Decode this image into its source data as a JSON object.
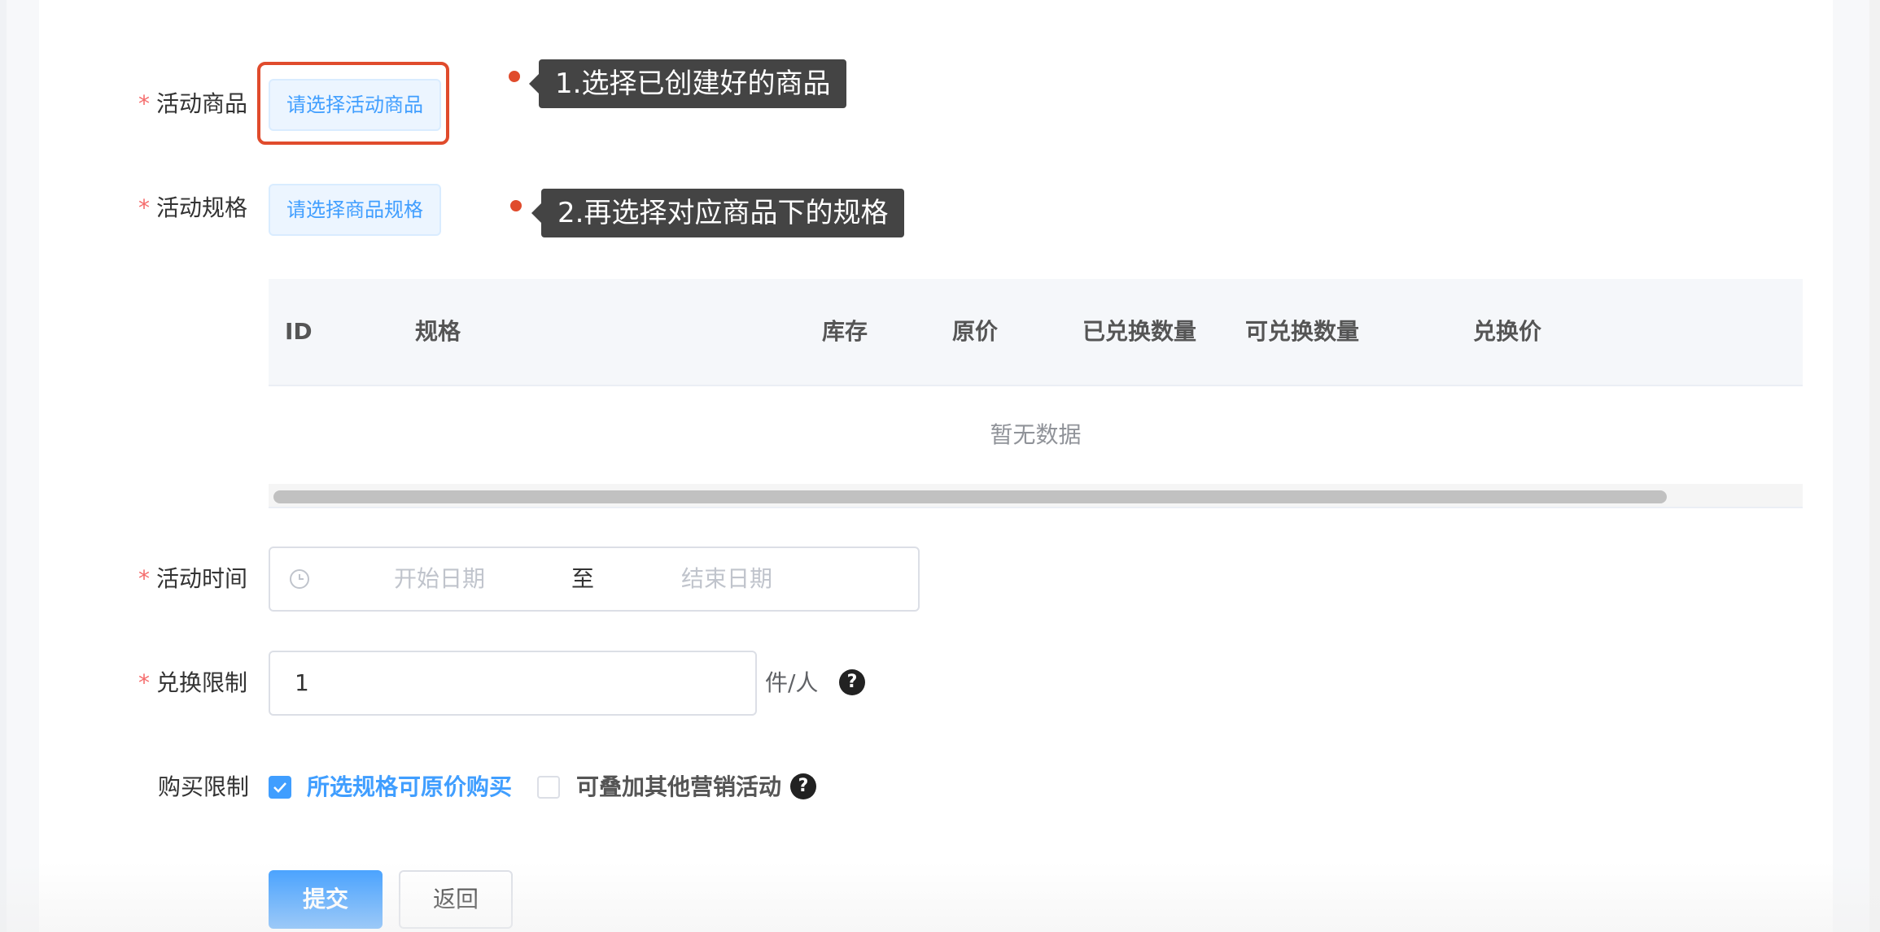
{
  "form": {
    "product": {
      "label": "活动商品",
      "button": "请选择活动商品",
      "tip": "1.选择已创建好的商品"
    },
    "spec": {
      "label": "活动规格",
      "button": "请选择商品规格",
      "tip": "2.再选择对应商品下的规格"
    },
    "table": {
      "columns": [
        "ID",
        "规格",
        "库存",
        "原价",
        "已兑换数量",
        "可兑换数量",
        "兑换价"
      ],
      "empty_text": "暂无数据"
    },
    "time": {
      "label": "活动时间",
      "start_placeholder": "开始日期",
      "separator": "至",
      "end_placeholder": "结束日期"
    },
    "limit": {
      "label": "兑换限制",
      "value": "1",
      "unit": "件/人",
      "help": "?"
    },
    "purchase": {
      "label": "购买限制",
      "option1": "所选规格可原价购买",
      "option1_checked": true,
      "option2": "可叠加其他营销活动",
      "option2_checked": false,
      "help": "?"
    },
    "required_mark": "*"
  },
  "actions": {
    "submit": "提交",
    "back": "返回"
  }
}
